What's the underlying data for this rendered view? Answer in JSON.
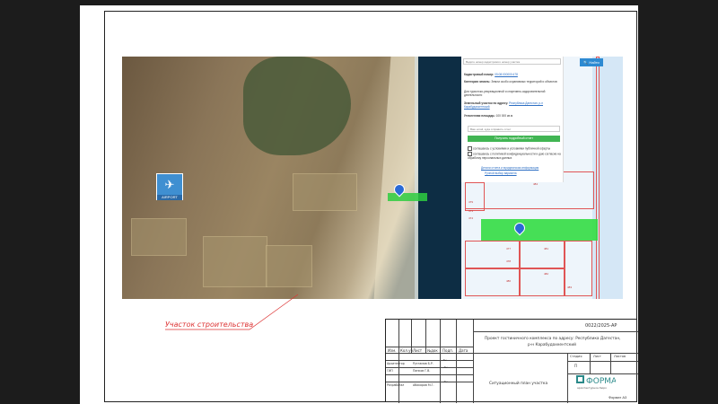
{
  "sheet": {
    "doc_code": "0022/2025-АР",
    "project_title_line1": "Проект гостиничного комплекса по адресу: Республика Дагестан,",
    "project_title_line2": "р-н Карабудахкентский",
    "sheet_title": "Ситуационный план участка",
    "stage_header": "Стадия",
    "sheet_header": "Лист",
    "sheets_header": "Листов",
    "stage_value": "П",
    "format": "Формат А3",
    "col_headers": [
      "Изм.",
      "Кол.уч",
      "Лист",
      "№док",
      "Подп.",
      "Дата"
    ],
    "people": [
      {
        "role": "Архитектор",
        "name": "Рустамов Б.Р."
      },
      {
        "role": "ГИП",
        "name": "Панков Г.В."
      },
      {
        "role": "Разработал",
        "name": "Абакаров М.Г."
      }
    ],
    "company": "ФОРМА",
    "company_sub": "архитектурное бюро"
  },
  "site_label": "Участок строительства",
  "map": {
    "airport_label": "AIRPORT",
    "airport_icon": "airplane-icon",
    "search_placeholder": "Ведите номер кадастрового номер участка",
    "find_button": "Найти",
    "cadastral_label": "Кадастровый номер:",
    "cadastral_value": "05:08:000000:478",
    "category_label": "Категория земель:",
    "category_value": "Земли особо охраняемых территорий и объектов",
    "use_label": "Для туристско-рекреационной и спортивно-оздоровительной деятельности",
    "address_label": "Земельный участок по адресу:",
    "address_value": "Республика Дагестан, р-н Карабудахкентский",
    "area_label": "Уточненная площадь:",
    "area_value": "100 000 кв.м",
    "email_placeholder": "Ваш email, куда отправить отчет",
    "report_button": "Получить подробный отчет",
    "consent_1": "соглашаюсь с условиями и условиями публичной оферты",
    "consent_2": "соглашаюсь с политикой конфиденциальности и даю согласие на обработку персональных данных",
    "details_link": "Детали отчета и юридическая информация",
    "manual_link": "Ручной выбор варианта",
    "lot_numbers": [
      "479",
      "473",
      "474",
      "477",
      "478",
      "480",
      "481",
      "482",
      "483",
      "484"
    ]
  },
  "colors": {
    "accent_green": "#33dd44",
    "button_blue": "#2d8ad2",
    "label_red": "#d33333"
  }
}
